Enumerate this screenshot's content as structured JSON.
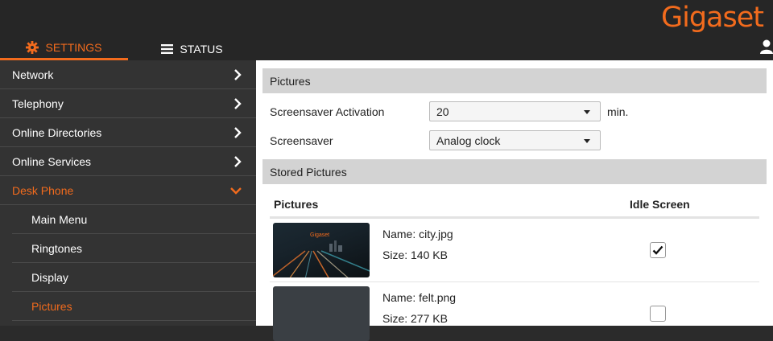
{
  "brand": {
    "logo_text": "Gigaset",
    "accent_color": "#f26b1d"
  },
  "tabs": [
    {
      "label": "SETTINGS",
      "icon": "gear-icon",
      "active": true
    },
    {
      "label": "STATUS",
      "icon": "menu-icon",
      "active": false
    }
  ],
  "user": {
    "icon": "user-icon"
  },
  "sidebar": {
    "items": [
      {
        "label": "Network",
        "icon": "chevron-right-icon"
      },
      {
        "label": "Telephony",
        "icon": "chevron-right-icon"
      },
      {
        "label": "Online Directories",
        "icon": "chevron-right-icon"
      },
      {
        "label": "Online Services",
        "icon": "chevron-right-icon"
      },
      {
        "label": "Desk Phone",
        "icon": "chevron-down-icon",
        "active": true
      }
    ],
    "subitems": [
      {
        "label": "Main Menu"
      },
      {
        "label": "Ringtones"
      },
      {
        "label": "Display"
      },
      {
        "label": "Pictures",
        "active": true
      }
    ]
  },
  "main": {
    "section1_title": "Pictures",
    "screensaver_activation": {
      "label": "Screensaver Activation",
      "value": "20",
      "unit": "min."
    },
    "screensaver": {
      "label": "Screensaver",
      "value": "Analog clock"
    },
    "section2_title": "Stored Pictures",
    "table": {
      "headers": {
        "pictures": "Pictures",
        "idle_screen": "Idle Screen"
      },
      "rows": [
        {
          "name": "Name: city.jpg",
          "size": "Size: 140 KB",
          "idle_screen": true,
          "thumb_text": "Gigaset"
        },
        {
          "name": "Name: felt.png",
          "size": "Size: 277 KB",
          "idle_screen": false
        }
      ]
    }
  }
}
